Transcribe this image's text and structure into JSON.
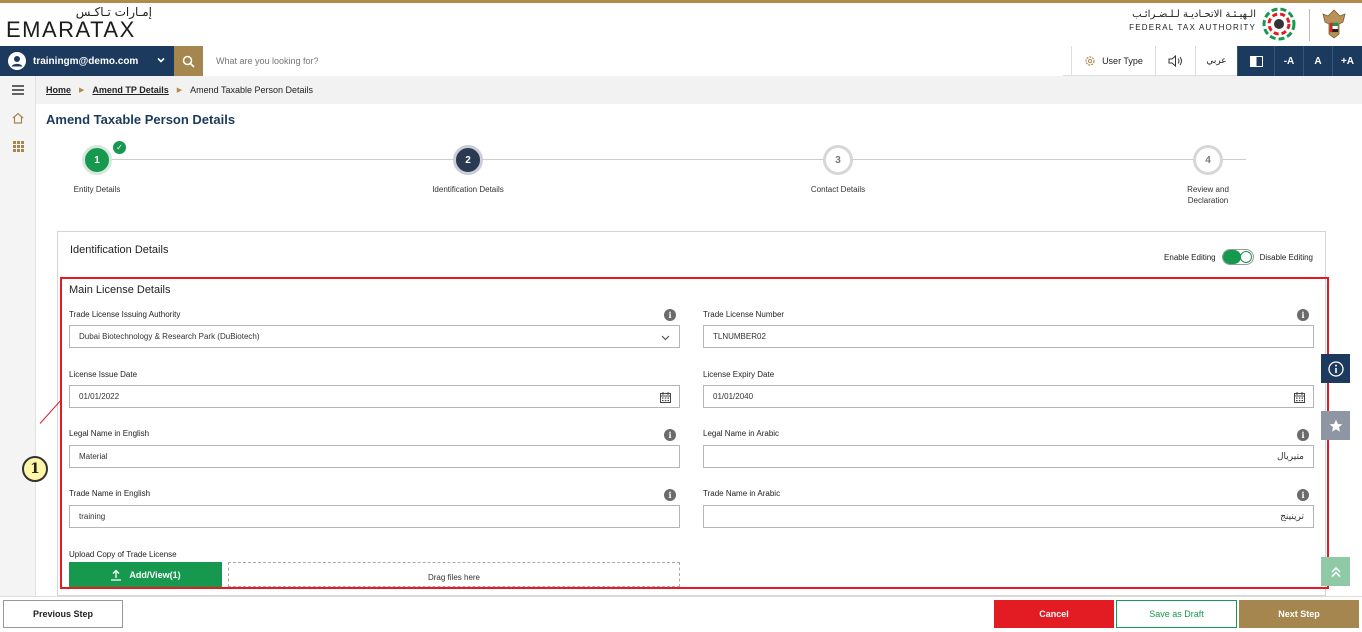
{
  "header": {
    "logo_ar": "إمـارات تـاكـس",
    "logo_en": "EMARATAX",
    "fta_ar": "الـهيـئـة الاتحـاديـة لـلـضـرائـب",
    "fta_en": "FEDERAL TAX AUTHORITY"
  },
  "navbar": {
    "user_email": "trainingm@demo.com",
    "search_placeholder": "What are you looking for?",
    "user_type": "User Type",
    "language": "عربي",
    "font_decrease": "-A",
    "font_normal": "A",
    "font_increase": "+A"
  },
  "breadcrumb": {
    "home": "Home",
    "amend_tp": "Amend TP Details",
    "current": "Amend Taxable Person Details"
  },
  "page": {
    "title": "Amend Taxable Person Details"
  },
  "stepper": {
    "steps": [
      {
        "number": "1",
        "label": "Entity Details",
        "status": "done"
      },
      {
        "number": "2",
        "label": "Identification Details",
        "status": "active"
      },
      {
        "number": "3",
        "label": "Contact Details",
        "status": "todo"
      },
      {
        "number": "4",
        "label": "Review and Declaration",
        "status": "todo"
      }
    ]
  },
  "card": {
    "title": "Identification Details",
    "enable_editing": "Enable Editing",
    "disable_editing": "Disable Editing"
  },
  "main_license": {
    "title": "Main License Details",
    "issuing_authority_label": "Trade License Issuing Authority",
    "issuing_authority_value": "Dubai Biotechnology & Research Park (DuBiotech)",
    "license_number_label": "Trade License Number",
    "license_number_value": "TLNUMBER02",
    "issue_date_label": "License Issue Date",
    "issue_date_value": "01/01/2022",
    "expiry_date_label": "License Expiry Date",
    "expiry_date_value": "01/01/2040",
    "legal_name_en_label": "Legal Name in English",
    "legal_name_en_value": "Material",
    "legal_name_ar_label": "Legal Name in Arabic",
    "legal_name_ar_value": "متيريال",
    "trade_name_en_label": "Trade Name in English",
    "trade_name_en_value": "training",
    "trade_name_ar_label": "Trade Name in Arabic",
    "trade_name_ar_value": "ترينينج",
    "upload_label": "Upload Copy of Trade License",
    "upload_button": "Add/View(1)",
    "dropzone_text": "Drag files here"
  },
  "callout": {
    "number": "1"
  },
  "footer": {
    "previous": "Previous Step",
    "cancel": "Cancel",
    "save_draft": "Save as Draft",
    "next": "Next Step"
  },
  "colors": {
    "navy": "#1c3a5e",
    "gold": "#a6864f",
    "green": "#16994f",
    "red": "#e31b23"
  }
}
